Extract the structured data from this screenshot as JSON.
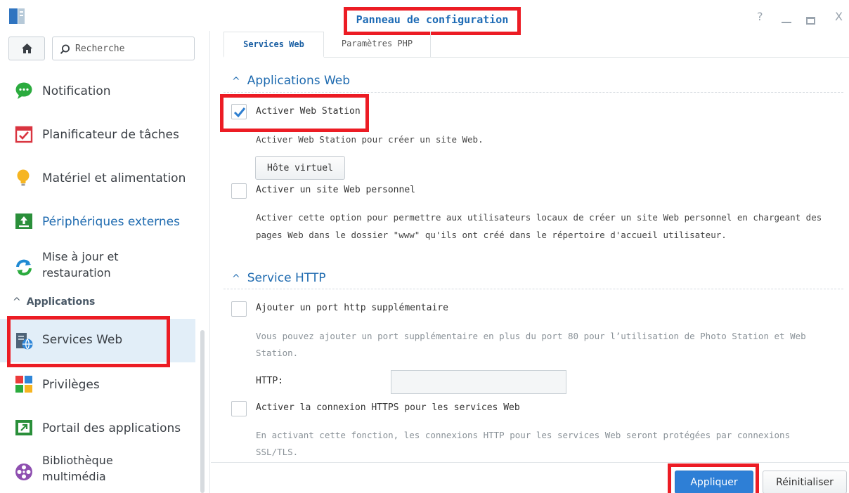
{
  "window": {
    "title": "Panneau de configuration",
    "controls": {
      "help": "?",
      "close": "X"
    }
  },
  "sidebar": {
    "search_placeholder": "Recherche",
    "items": [
      {
        "label": "Notification",
        "icon": "notification-icon"
      },
      {
        "label": "Planificateur de tâches",
        "icon": "calendar-icon"
      },
      {
        "label": "Matériel et alimentation",
        "icon": "bulb-icon"
      },
      {
        "label": "Périphériques externes",
        "icon": "external-device-icon"
      },
      {
        "label_line1": "Mise à jour et",
        "label_line2": "restauration",
        "icon": "update-icon"
      }
    ],
    "section": "Applications",
    "app_items": [
      {
        "label": "Services Web",
        "icon": "web-services-icon",
        "active": true
      },
      {
        "label": "Privilèges",
        "icon": "privileges-icon"
      },
      {
        "label": "Portail des applications",
        "icon": "portal-icon"
      },
      {
        "label_line1": "Bibliothèque",
        "label_line2": "multimédia",
        "icon": "media-library-icon"
      }
    ]
  },
  "tabs": [
    {
      "label": "Services Web",
      "active": true
    },
    {
      "label": "Paramètres PHP",
      "active": false
    }
  ],
  "web_apps": {
    "heading": "Applications Web",
    "enable_web_station": {
      "label": "Activer Web Station",
      "checked": true
    },
    "web_station_desc": "Activer Web Station pour créer un site Web.",
    "vhost_button": "Hôte virtuel",
    "personal_site": {
      "label": "Activer un site Web personnel",
      "checked": false
    },
    "personal_desc_line1": "Activer cette option pour permettre aux utilisateurs locaux de créer un site Web personnel en chargeant des",
    "personal_desc_line2": "pages Web dans le dossier \"www\" qu'ils ont créé dans le répertoire d'accueil utilisateur."
  },
  "http_service": {
    "heading": "Service HTTP",
    "extra_port": {
      "label": "Ajouter un port http supplémentaire",
      "checked": false
    },
    "extra_port_desc_line1": "Vous pouvez ajouter un port supplémentaire en plus du port 80 pour l’utilisation de Photo Station et Web",
    "extra_port_desc_line2": "Station.",
    "http_label": "HTTP:",
    "http_value": "",
    "https": {
      "label": "Activer la connexion HTTPS pour les services Web",
      "checked": false
    },
    "https_desc_line1": "En activant cette fonction, les connexions HTTP pour les services Web seront protégées par connexions",
    "https_desc_line2": "SSL/TLS."
  },
  "footer": {
    "apply": "Appliquer",
    "reset": "Réinitialiser"
  },
  "colors": {
    "accent": "#1f6bb0",
    "highlight_box": "#ec1c24",
    "apply_button": "#2e7fd6",
    "active_row": "#e2eef8"
  }
}
